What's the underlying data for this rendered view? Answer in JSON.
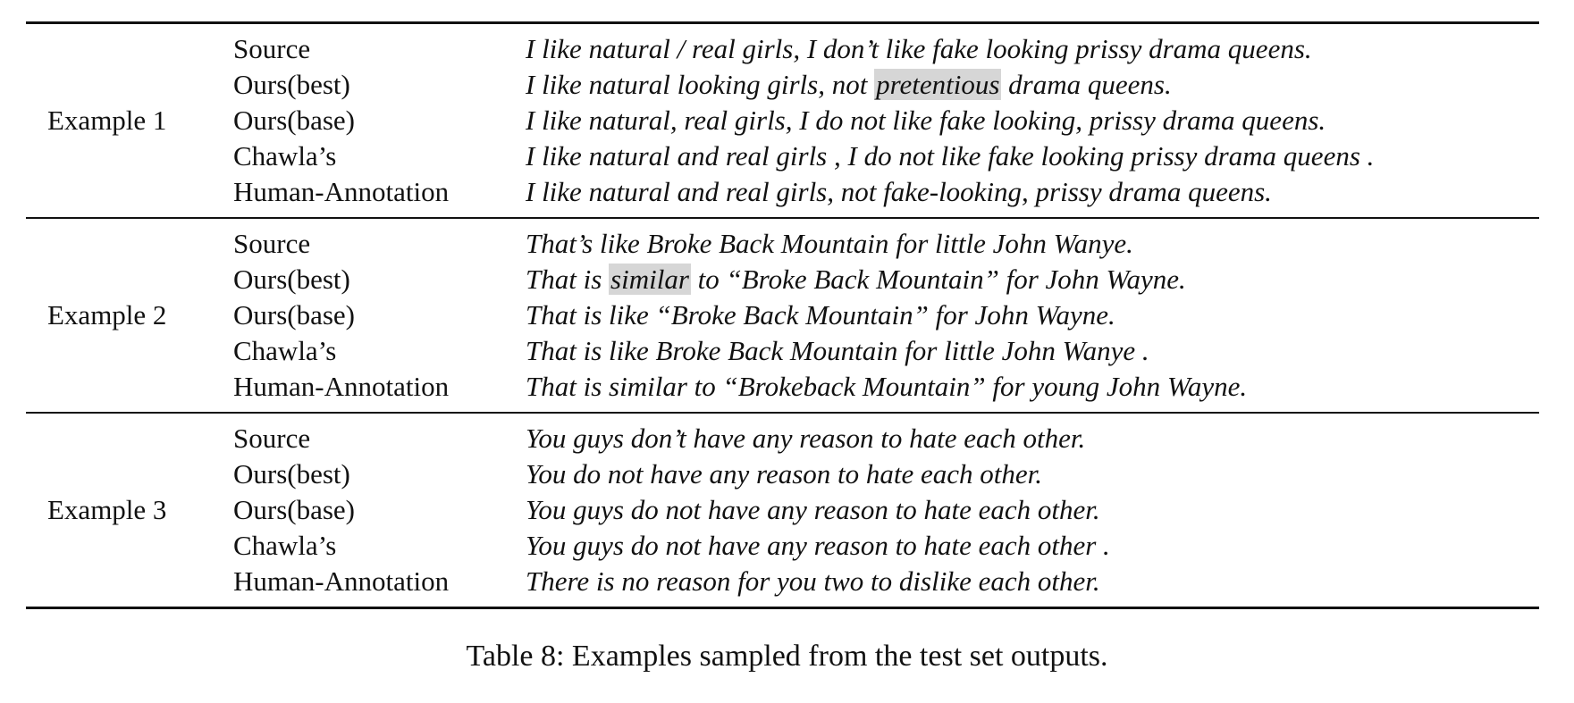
{
  "examples": [
    {
      "label": "Example 1",
      "rows": [
        {
          "system": "Source",
          "pre": "I like natural / real girls, I don’t like fake looking prissy drama queens.",
          "highlight": "",
          "post": ""
        },
        {
          "system": "Ours(best)",
          "pre": "I like natural looking girls, not ",
          "highlight": "pretentious",
          "post": " drama queens."
        },
        {
          "system": "Ours(base)",
          "pre": "I like natural, real girls, I do not like fake looking, prissy drama queens.",
          "highlight": "",
          "post": ""
        },
        {
          "system": "Chawla’s",
          "pre": "I like natural and real girls , I do not like fake looking prissy drama queens .",
          "highlight": "",
          "post": ""
        },
        {
          "system": "Human-Annotation",
          "pre": "I like natural and real girls, not fake-looking, prissy drama queens.",
          "highlight": "",
          "post": ""
        }
      ]
    },
    {
      "label": "Example 2",
      "rows": [
        {
          "system": "Source",
          "pre": "That’s like Broke Back Mountain for little John Wanye.",
          "highlight": "",
          "post": ""
        },
        {
          "system": "Ours(best)",
          "pre": "That is ",
          "highlight": "similar",
          "post": " to “Broke Back Mountain” for John Wayne."
        },
        {
          "system": "Ours(base)",
          "pre": "That is like “Broke Back Mountain” for John Wayne.",
          "highlight": "",
          "post": ""
        },
        {
          "system": "Chawla’s",
          "pre": "That is like Broke Back Mountain for little John Wanye .",
          "highlight": "",
          "post": ""
        },
        {
          "system": "Human-Annotation",
          "pre": "That is similar to “Brokeback Mountain” for young John Wayne.",
          "highlight": "",
          "post": ""
        }
      ]
    },
    {
      "label": "Example 3",
      "rows": [
        {
          "system": "Source",
          "pre": "You guys don’t have any reason to hate each other.",
          "highlight": "",
          "post": ""
        },
        {
          "system": "Ours(best)",
          "pre": "You do not have any reason to hate each other.",
          "highlight": "",
          "post": ""
        },
        {
          "system": "Ours(base)",
          "pre": "You guys do not have any reason to hate each other.",
          "highlight": "",
          "post": ""
        },
        {
          "system": "Chawla’s",
          "pre": "You guys do not have any reason to hate each other .",
          "highlight": "",
          "post": ""
        },
        {
          "system": "Human-Annotation",
          "pre": "There is no reason for you two to dislike each other.",
          "highlight": "",
          "post": ""
        }
      ]
    }
  ],
  "caption": "Table 8: Examples sampled from the test set outputs.",
  "colors": {
    "text": "#111111",
    "highlight": "#d6d6d6",
    "background": "#ffffff"
  }
}
